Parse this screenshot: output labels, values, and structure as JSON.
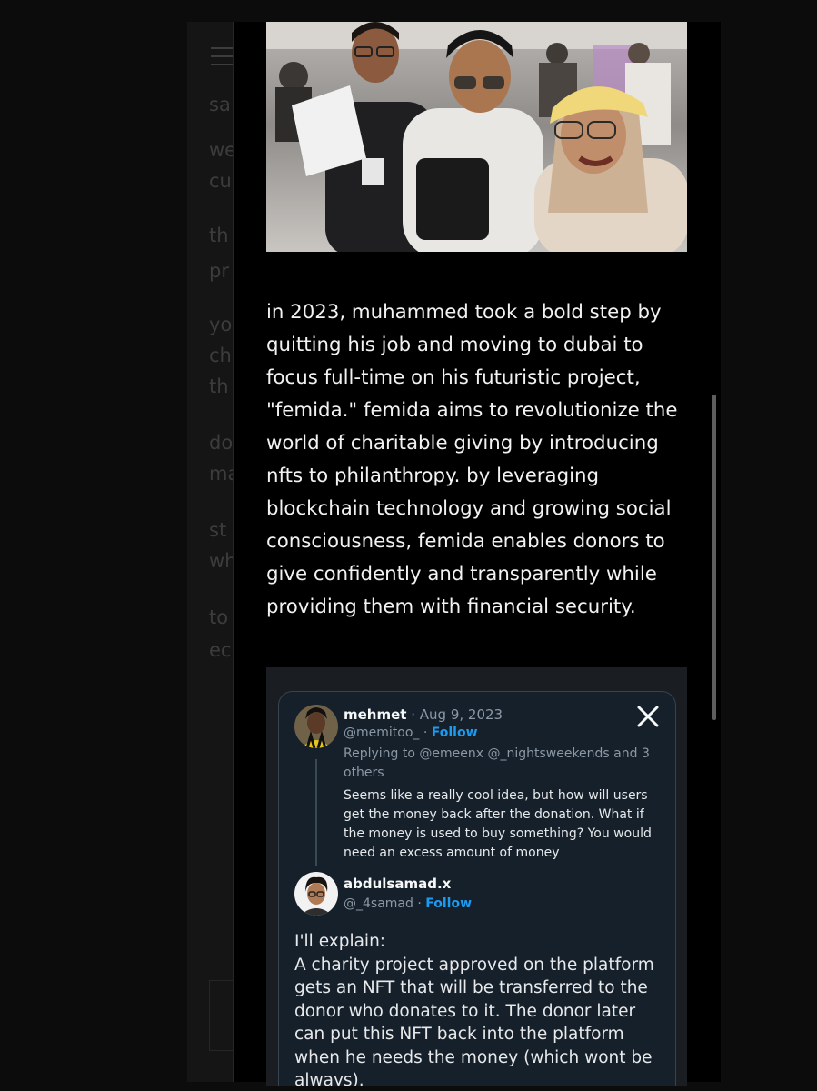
{
  "background_sidebar": {
    "fragments": [
      "sa",
      "we",
      "cu",
      "th",
      "pr",
      "yo",
      "ch",
      "th",
      "do",
      "ma",
      "st",
      "wh",
      "to",
      "ec"
    ]
  },
  "article": {
    "paragraph": "in 2023, muhammed took a bold step by quitting his job and moving to dubai to focus full-time on his futuristic project, \"femida.\" femida aims to revolutionize the world of charitable giving by introducing nfts to philanthropy. by leveraging blockchain technology and growing social consciousness, femida enables donors to give confidently and transparently while providing them with financial security."
  },
  "tweet": {
    "first": {
      "name": "mehmet",
      "date": " · Aug 9, 2023",
      "handle": "@memitoo_",
      "separator": " · ",
      "follow": "Follow",
      "replying_to": "Replying to @emeenx @_nightsweekends and 3 others",
      "text": "Seems like a really cool idea, but how will users get the money back after the donation. What if the money is used to buy something? You would need an excess amount of money"
    },
    "second": {
      "name": "abdulsamad.x",
      "handle": "@_4samad",
      "separator": " · ",
      "follow": "Follow",
      "text": "I'll explain:\nA charity project approved on the platform gets an NFT that will be transferred to the donor who donates to it. The donor later can put this NFT back into the platform when he needs the money (which wont be always)."
    }
  },
  "icons": {
    "menu": "hamburger-menu-icon",
    "x_logo": "x-logo-icon"
  },
  "colors": {
    "page_background": "#0c0c0c",
    "article_text": "#f2f2f2",
    "tweet_background": "#15202b",
    "tweet_follow": "#1d9bf0",
    "tweet_meta": "#8b98a5"
  }
}
